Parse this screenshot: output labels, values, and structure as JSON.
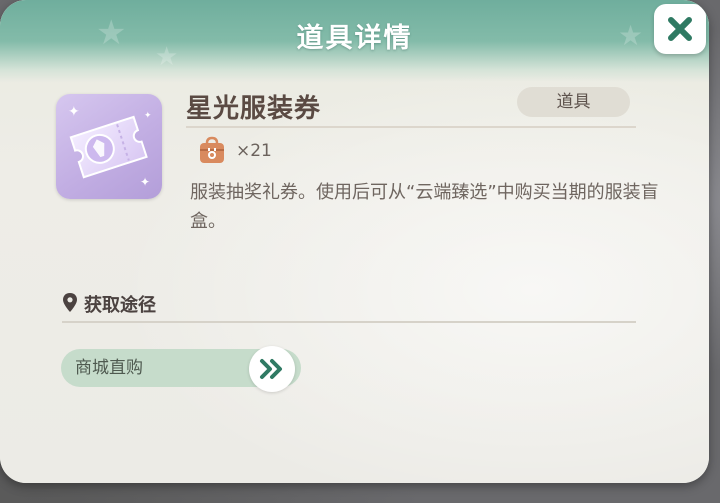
{
  "dialog": {
    "title": "道具详情",
    "close_icon": "close-icon"
  },
  "item": {
    "name": "星光服装券",
    "type": "道具",
    "icon": "star-ticket-icon",
    "owned_icon": "bag-icon",
    "count": "×21",
    "description": "服装抽奖礼券。使用后可从“云端臻选”中购买当期的服装盲盒。"
  },
  "source": {
    "icon": "location-pin-icon",
    "title": "获取途径",
    "options": [
      {
        "label": "商城直购",
        "go_icon": "double-chevron-right-icon"
      }
    ]
  },
  "colors": {
    "header": "#7ab5a3",
    "panel": "#ecebe5",
    "accent_green": "#2f7a63",
    "source_button": "#c6dccb",
    "bag": "#d98a5e",
    "ticket": "#c2aee3"
  }
}
